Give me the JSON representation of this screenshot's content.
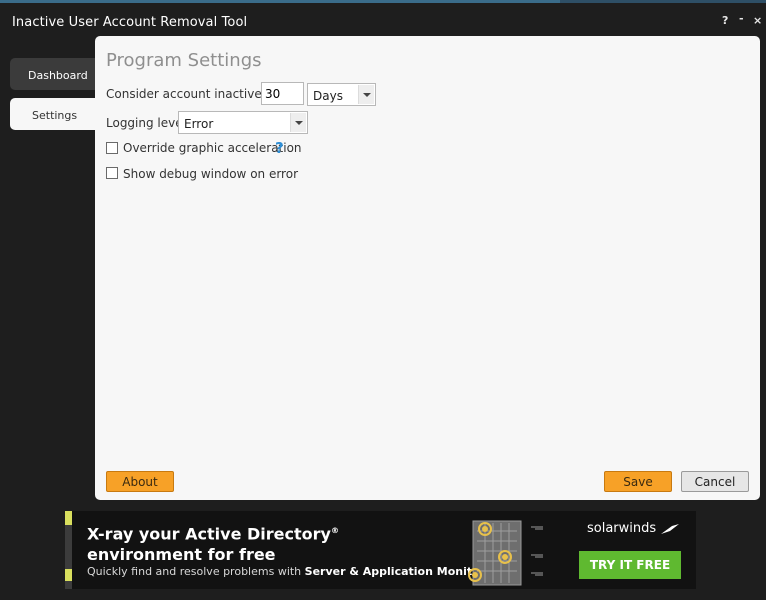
{
  "window": {
    "title": "Inactive User Account Removal Tool",
    "help_glyph": "?",
    "minimize_glyph": "-",
    "close_glyph": "×"
  },
  "nav": {
    "items": [
      {
        "label": "Dashboard",
        "active": false
      },
      {
        "label": "Settings",
        "active": true
      }
    ]
  },
  "settings": {
    "title": "Program Settings",
    "inactive_label": "Consider account inactive after",
    "inactive_value": "30",
    "period_selected": "Days",
    "logging_label": "Logging level",
    "logging_selected": "Error",
    "override_label": "Override graphic acceleration",
    "override_checked": false,
    "debug_label": "Show debug window on error",
    "debug_checked": false,
    "help_glyph": "?"
  },
  "buttons": {
    "about": "About",
    "save": "Save",
    "cancel": "Cancel"
  },
  "banner": {
    "headline_line1": "X-ray your Active Directory",
    "registered": "®",
    "headline_line2": "environment for free",
    "sub_prefix": "Quickly find and resolve problems with",
    "sub_bold": "Server & Application Monitor",
    "logo": "solarwinds",
    "cta": "TRY IT FREE"
  },
  "colors": {
    "accent": "#f7a127",
    "cta": "#5fb930",
    "help": "#2f8fd6"
  }
}
